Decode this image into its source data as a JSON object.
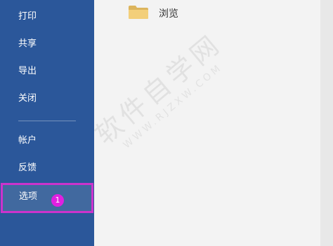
{
  "sidebar": {
    "items": [
      {
        "label": "打印"
      },
      {
        "label": "共享"
      },
      {
        "label": "导出"
      },
      {
        "label": "关闭"
      },
      {
        "label": "帐户"
      },
      {
        "label": "反馈"
      },
      {
        "label": "选项"
      }
    ],
    "selected_badge": "1",
    "colors": {
      "background": "#2b579a",
      "highlight": "#cc33cc"
    }
  },
  "main": {
    "browse_label": "浏览",
    "browse_icon": "folder-icon"
  },
  "watermark": {
    "text": "软件自学网",
    "url": "WWW.RJZXW.COM"
  }
}
